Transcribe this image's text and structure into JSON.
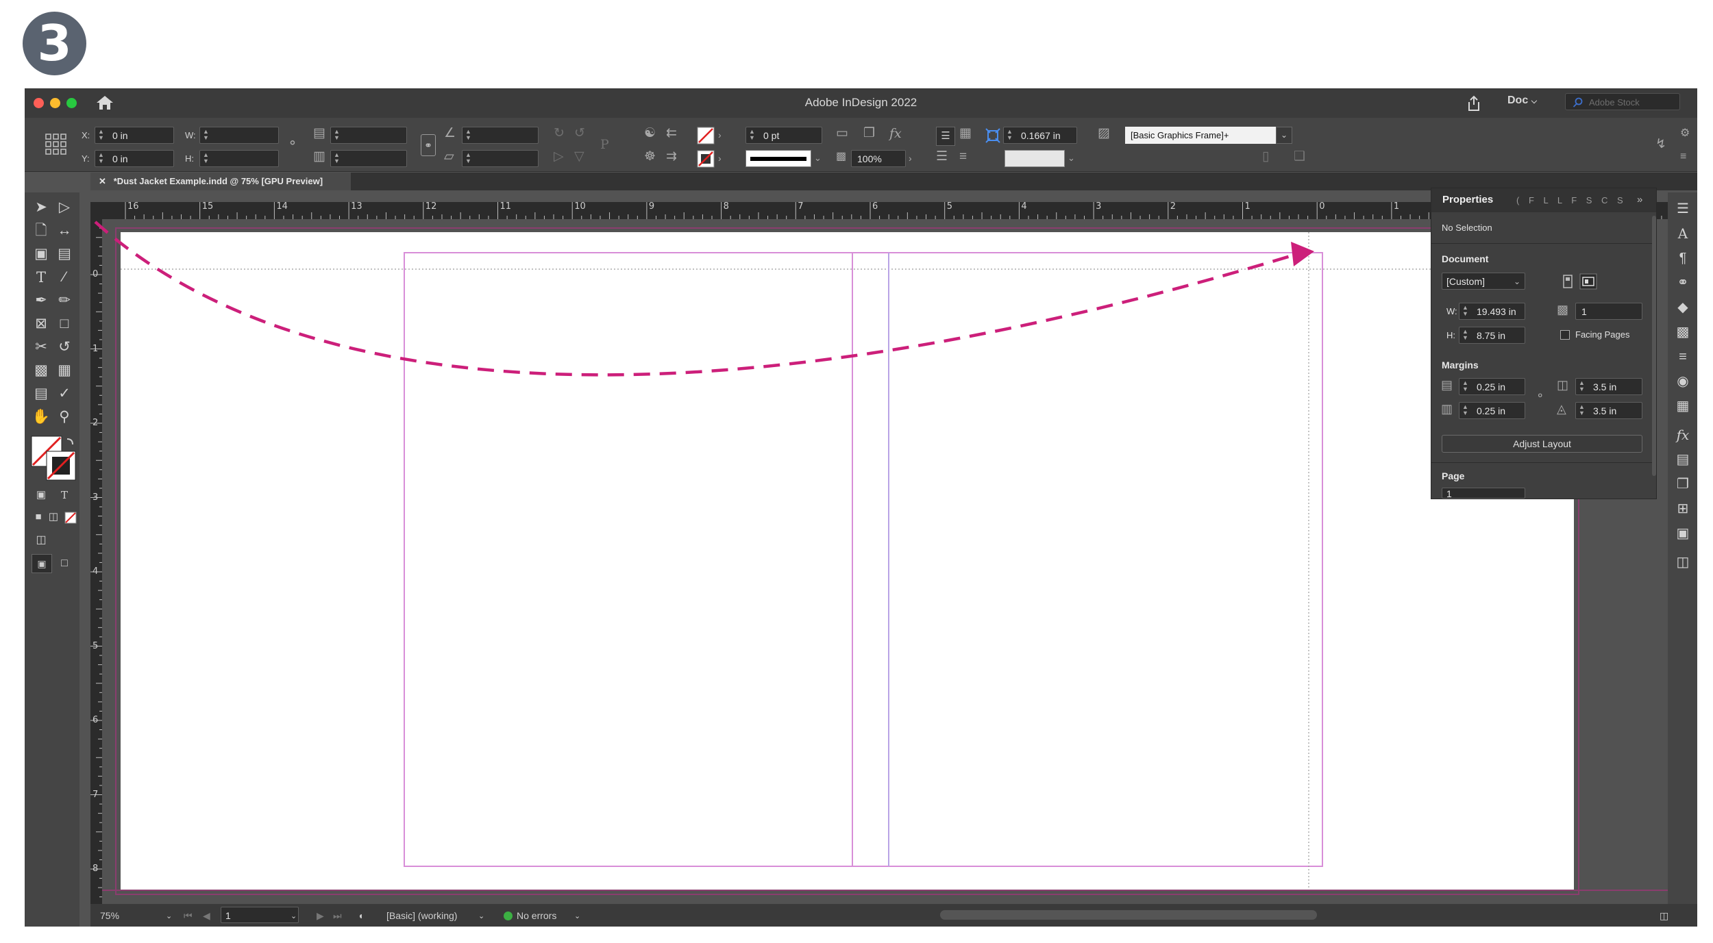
{
  "step_badge": "3",
  "app_title": "Adobe InDesign 2022",
  "titlebar": {
    "doc_menu": "Doc",
    "stock_placeholder": "Adobe Stock"
  },
  "control": {
    "x_label": "X:",
    "x_value": "0 in",
    "y_label": "Y:",
    "y_value": "0 in",
    "w_label": "W:",
    "h_label": "H:",
    "stroke_weight": "0 pt",
    "opacity": "100%",
    "fitting_value": "0.1667 in",
    "object_style": "[Basic Graphics Frame]+"
  },
  "document_tab": "*Dust Jacket Example.indd @ 75% [GPU Preview]",
  "ruler_h_labels": [
    "16",
    "15",
    "14",
    "13",
    "12",
    "11",
    "10",
    "9",
    "8",
    "7",
    "6",
    "5",
    "4",
    "3",
    "2",
    "1",
    "0",
    "1"
  ],
  "ruler_v_labels": [
    "0",
    "1",
    "2",
    "3",
    "4",
    "5",
    "6",
    "7",
    "8"
  ],
  "properties_panel": {
    "tab_title": "Properties",
    "other_tabs": "( F L L F S C S",
    "selection": "No Selection",
    "document_heading": "Document",
    "preset": "[Custom]",
    "w_label": "W:",
    "width": "19.493 in",
    "h_label": "H:",
    "height": "8.75 in",
    "pages": "1",
    "facing_pages": "Facing Pages",
    "facing_checked": false,
    "margins_heading": "Margins",
    "margin_top": "0.25 in",
    "margin_bottom": "0.25 in",
    "margin_inside": "3.5 in",
    "margin_outside": "3.5 in",
    "adjust_layout": "Adjust Layout",
    "page_heading": "Page",
    "page_value": "1"
  },
  "status": {
    "zoom": "75%",
    "page": "1",
    "preflight_profile": "[Basic] (working)",
    "errors": "No errors"
  },
  "colors": {
    "arrow": "#cc1f7a",
    "guide_magenta": "#d88ed8",
    "guide_violet": "#b9a3e6",
    "no_errors_dot": "#3cb043"
  }
}
